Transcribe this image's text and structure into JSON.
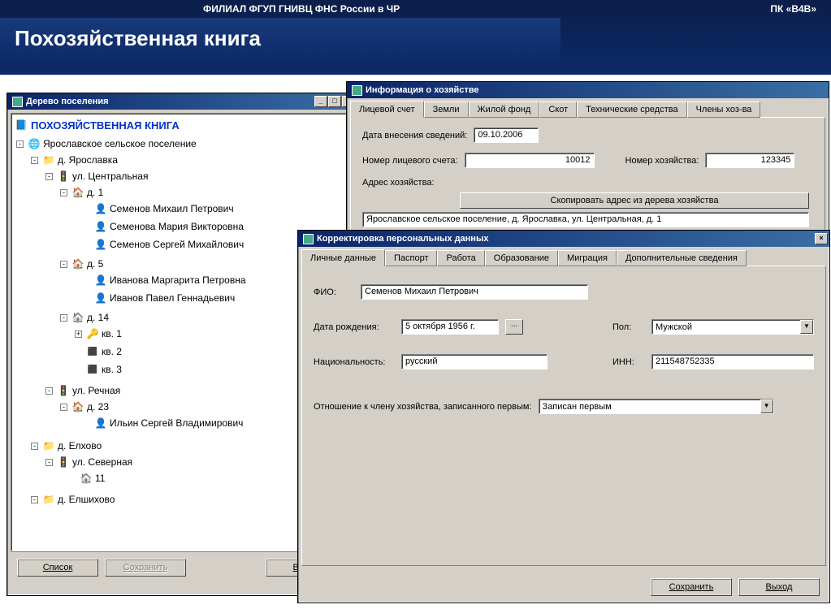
{
  "banner": {
    "org": "ФИЛИАЛ ФГУП ГНИВЦ ФНС России в ЧР",
    "product": "ПК «B4B»",
    "title": "Похозяйственная книга"
  },
  "tree_window": {
    "title": "Дерево поселения",
    "root": "ПОХОЗЯЙСТВЕННАЯ КНИГА",
    "settlement": "Ярославское сельское поселение",
    "villages": [
      {
        "name": "д. Ярославка"
      },
      {
        "name": "д. Елхово"
      },
      {
        "name": "д. Елшихово"
      }
    ],
    "streets": {
      "central": "ул. Центральная",
      "river": "ул. Речная",
      "north": "ул. Северная"
    },
    "houses": {
      "h1": "д. 1",
      "h5": "д. 5",
      "h14": "д. 14",
      "h23": "д. 23",
      "h11": "11"
    },
    "apts": {
      "a1": "кв. 1",
      "a2": "кв. 2",
      "a3": "кв. 3"
    },
    "people": {
      "p1": "Семенов Михаил Петрович",
      "p2": "Семенова Мария Викторовна",
      "p3": "Семенов Сергей Михайлович",
      "p4": "Иванова Маргарита Петровна",
      "p5": "Иванов Павел Геннадьевич",
      "p6": "Ильин Сергей Владимирович"
    },
    "buttons": {
      "list": "Список",
      "save": "Сохранить",
      "exit": "Выход"
    }
  },
  "household_window": {
    "title": "Информация о хозяйстве",
    "tabs": [
      "Лицевой счет",
      "Земли",
      "Жилой фонд",
      "Скот",
      "Технические средства",
      "Члены хоз-ва"
    ],
    "labels": {
      "entry_date": "Дата внесения сведений:",
      "account_no": "Номер лицевого счета:",
      "household_no": "Номер хозяйства:",
      "address": "Адрес хозяйства:",
      "copy_address": "Скопировать адрес из дерева хозяйства"
    },
    "values": {
      "entry_date": "09.10.2006",
      "account_no": "10012",
      "household_no": "123345",
      "address": "Ярославское сельское поселение, д. Ярославка, ул. Центральная, д. 1"
    }
  },
  "personal_window": {
    "title": "Корректировка персональных данных",
    "tabs": [
      "Личные данные",
      "Паспорт",
      "Работа",
      "Образование",
      "Миграция",
      "Дополнительные сведения"
    ],
    "labels": {
      "fio": "ФИО:",
      "dob": "Дата рождения:",
      "sex": "Пол:",
      "nationality": "Национальность:",
      "inn": "ИНН:",
      "relation": "Отношение к члену хозяйства, записанного первым:"
    },
    "values": {
      "fio": "Семенов Михаил Петрович",
      "dob": "5 октября 1956 г.",
      "sex": "Мужской",
      "nationality": "русский",
      "inn": "211548752335",
      "relation": "Записан первым"
    },
    "buttons": {
      "save": "Сохранить",
      "exit": "Выход"
    }
  }
}
